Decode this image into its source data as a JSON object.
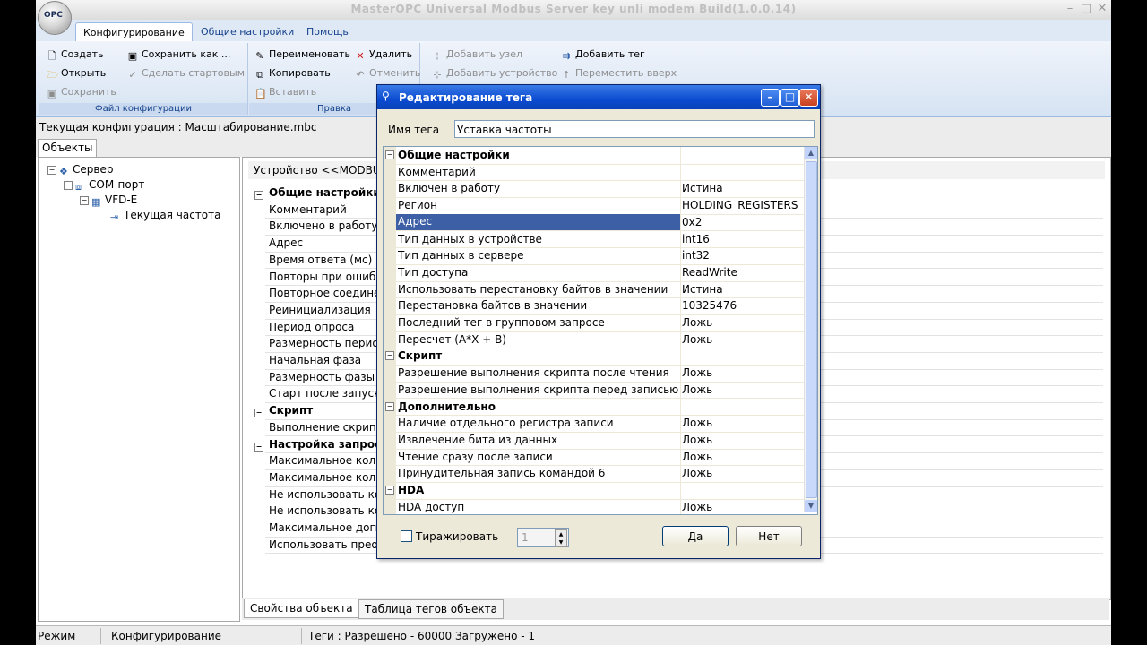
{
  "window": {
    "title": "MasterOPC Universal Modbus Server key unli modem Build(1.0.0.14)",
    "logo_text": "OPC",
    "min": "–",
    "max": "□",
    "close": "✕"
  },
  "ribbon": {
    "tabs": [
      "Конфигурирование",
      "Общие настройки",
      "Помощь"
    ],
    "file_group": {
      "title": "Файл конфигурации",
      "create": "Создать",
      "open": "Открыть",
      "save": "Сохранить",
      "save_as": "Сохранить как ...",
      "make_start": "Сделать стартовым"
    },
    "edit_group": {
      "title": "Правка",
      "rename": "Переименовать",
      "delete": "Удалить",
      "copy": "Копировать",
      "undo": "Отменить",
      "paste": "Вставить"
    },
    "node_group": {
      "add_node": "Добавить узел",
      "add_tag": "Добавить тег",
      "add_device": "Добавить устройство",
      "move_up": "Переместить вверх"
    }
  },
  "config_bar": "Текущая конфигурация : Масштабирование.mbc",
  "objects_tab": "Объекты",
  "tree": {
    "server": "Сервер",
    "com_port": "COM-порт",
    "device": "VFD-E",
    "tag": "Текущая частота"
  },
  "right_pane": {
    "header": "Устройство <<MODBUS",
    "rows": [
      {
        "label": "Общие настройки",
        "cat": true
      },
      {
        "label": "Комментарий",
        "cat": false
      },
      {
        "label": "Включено в работу",
        "cat": false
      },
      {
        "label": "Адрес",
        "cat": false
      },
      {
        "label": "Время ответа (мс)",
        "cat": false
      },
      {
        "label": "Повторы при ошибке",
        "cat": false
      },
      {
        "label": "Повторное соединение",
        "cat": false
      },
      {
        "label": "Реинициализация",
        "cat": false
      },
      {
        "label": "Период опроса",
        "cat": false
      },
      {
        "label": "Размерность периода",
        "cat": false
      },
      {
        "label": "Начальная фаза",
        "cat": false
      },
      {
        "label": "Размерность фазы",
        "cat": false
      },
      {
        "label": "Старт после запуска",
        "cat": false
      },
      {
        "label": "Скрипт",
        "cat": true
      },
      {
        "label": "Выполнение скрипта",
        "cat": false
      },
      {
        "label": "Настройка запросов",
        "cat": true
      },
      {
        "label": "Максимальное количество",
        "cat": false
      },
      {
        "label": "Максимальное количество",
        "cat": false
      },
      {
        "label": "Не использовать команду",
        "cat": false
      },
      {
        "label": "Не использовать команду",
        "cat": false
      },
      {
        "label": "Максимальное допустимое",
        "cat": false
      },
      {
        "label": "Использовать преобразование",
        "cat": false
      }
    ]
  },
  "bottom_tabs": [
    "Свойства объекта",
    "Таблица тегов объекта"
  ],
  "status": {
    "mode_label": "Режим",
    "mode_value": "Конфигурирование",
    "tags": "Теги : Разрешено - 60000 Загружено - 1"
  },
  "dialog": {
    "title": "Редактирование тега",
    "tag_name_label": "Имя тега",
    "tag_name_value": "Уставка частоты",
    "rows": [
      {
        "label": "Общие настройки",
        "value": "",
        "cat": true,
        "sel": false
      },
      {
        "label": "Комментарий",
        "value": "",
        "cat": false,
        "sel": false
      },
      {
        "label": "Включен в работу",
        "value": "Истина",
        "cat": false,
        "sel": false
      },
      {
        "label": "Регион",
        "value": "HOLDING_REGISTERS",
        "cat": false,
        "sel": false
      },
      {
        "label": "Адрес",
        "value": "0x2",
        "cat": false,
        "sel": true
      },
      {
        "label": "Тип данных в устройстве",
        "value": "int16",
        "cat": false,
        "sel": false
      },
      {
        "label": "Тип данных в сервере",
        "value": "int32",
        "cat": false,
        "sel": false
      },
      {
        "label": "Тип доступа",
        "value": "ReadWrite",
        "cat": false,
        "sel": false
      },
      {
        "label": "Использовать перестановку байтов в значении",
        "value": "Истина",
        "cat": false,
        "sel": false
      },
      {
        "label": "Перестановка байтов в значении",
        "value": "10325476",
        "cat": false,
        "sel": false
      },
      {
        "label": "Последний тег в групповом запросе",
        "value": "Ложь",
        "cat": false,
        "sel": false
      },
      {
        "label": "Пересчет (A*X + B)",
        "value": "Ложь",
        "cat": false,
        "sel": false
      },
      {
        "label": "Скрипт",
        "value": "",
        "cat": true,
        "sel": false
      },
      {
        "label": "Разрешение выполнения скрипта после чтения",
        "value": "Ложь",
        "cat": false,
        "sel": false
      },
      {
        "label": "Разрешение выполнения скрипта перед записью",
        "value": "Ложь",
        "cat": false,
        "sel": false
      },
      {
        "label": "Дополнительно",
        "value": "",
        "cat": true,
        "sel": false
      },
      {
        "label": "Наличие отдельного регистра записи",
        "value": "Ложь",
        "cat": false,
        "sel": false
      },
      {
        "label": "Извлечение бита из данных",
        "value": "Ложь",
        "cat": false,
        "sel": false
      },
      {
        "label": "Чтение сразу после записи",
        "value": "Ложь",
        "cat": false,
        "sel": false
      },
      {
        "label": "Принудительная запись командой 6",
        "value": "Ложь",
        "cat": false,
        "sel": false
      },
      {
        "label": "HDA",
        "value": "",
        "cat": true,
        "sel": false
      },
      {
        "label": "HDA доступ",
        "value": "Ложь",
        "cat": false,
        "sel": false
      }
    ],
    "replicate_label": "Тиражировать",
    "replicate_count": "1",
    "ok": "Да",
    "cancel": "Нет"
  }
}
